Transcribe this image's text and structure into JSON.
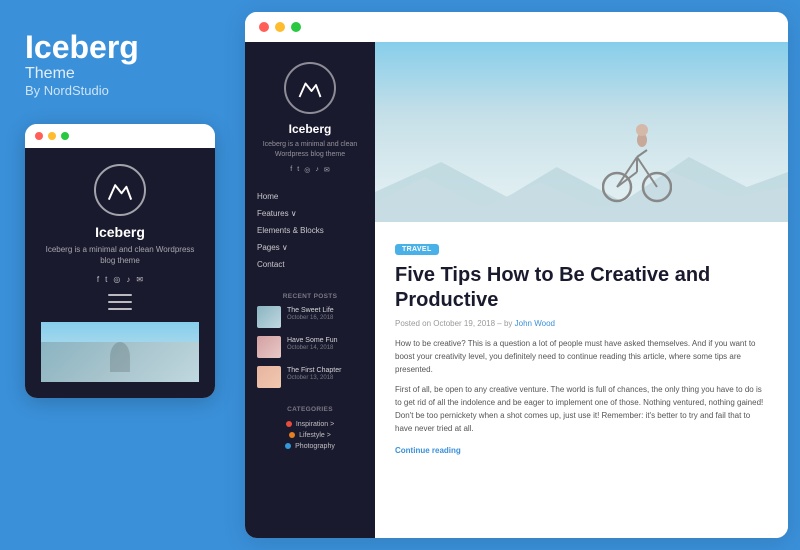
{
  "brand": {
    "title": "Iceberg",
    "subtitle": "Theme",
    "by": "By NordStudio"
  },
  "mobile": {
    "brand_name": "Iceberg",
    "brand_desc": "Iceberg is a minimal and clean Wordpress blog theme"
  },
  "sidebar": {
    "name": "Iceberg",
    "desc": "Iceberg is a minimal and clean Wordpress blog theme",
    "nav": [
      {
        "label": "Home"
      },
      {
        "label": "Features ∨"
      },
      {
        "label": "Elements & Blocks"
      },
      {
        "label": "Pages ∨"
      },
      {
        "label": "Contact"
      }
    ],
    "recent_posts_title": "RECENT POSTS",
    "recent_posts": [
      {
        "title": "The Sweet Life",
        "date": "October 16, 2018",
        "thumb": "t1"
      },
      {
        "title": "Have Some Fun",
        "date": "October 14, 2018",
        "thumb": "t2"
      },
      {
        "title": "The First Chapter",
        "date": "October 13, 2018",
        "thumb": "t3"
      }
    ],
    "categories_title": "CATEGORIES",
    "categories": [
      {
        "name": "Inspiration >",
        "color": "red"
      },
      {
        "name": "Lifestyle >",
        "color": "orange"
      },
      {
        "name": "Photography",
        "color": "blue"
      }
    ]
  },
  "article": {
    "tag": "TRAVEL",
    "title": "Five Tips How to Be Creative and Productive",
    "meta": "Posted on October 19, 2018 - by John Wood",
    "body_1": "How to be creative? This is a question a lot of people must have asked themselves. And if you want to boost your creativity level, you definitely need to continue reading this article, where some tips are presented.",
    "body_2": "First of all, be open to any creative venture. The world is full of chances, the only thing you have to do is to get rid of all the indolence and be eager to implement one of those. Nothing ventured, nothing gained! Don't be too pernickety when a shot comes up, just use it! Remember: it's better to try and fail that to have never tried at all.",
    "read_more": "Continue reading"
  }
}
